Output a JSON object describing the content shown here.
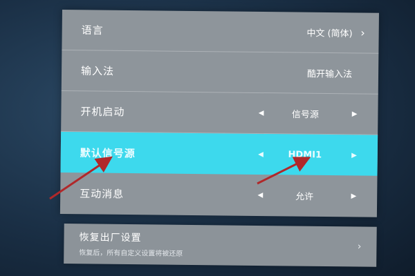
{
  "settings": {
    "items": [
      {
        "label": "语言",
        "value": "中文 (简体)"
      },
      {
        "label": "输入法",
        "value": "酷开输入法"
      },
      {
        "label": "开机启动",
        "value": "信号源"
      },
      {
        "label": "默认信号源",
        "value": "HDMI1"
      },
      {
        "label": "互动消息",
        "value": "允许"
      }
    ],
    "reset": {
      "title": "恢复出厂设置",
      "description": "恢复后，所有自定义设置将被还原"
    }
  },
  "icons": {
    "chevron_right": "›",
    "arrow_left": "◀",
    "arrow_right": "▶"
  },
  "colors": {
    "panel": "#8e959b",
    "highlight": "#3dd9ed",
    "annotation_arrow": "#b0282a",
    "background": "#1a2f45"
  }
}
